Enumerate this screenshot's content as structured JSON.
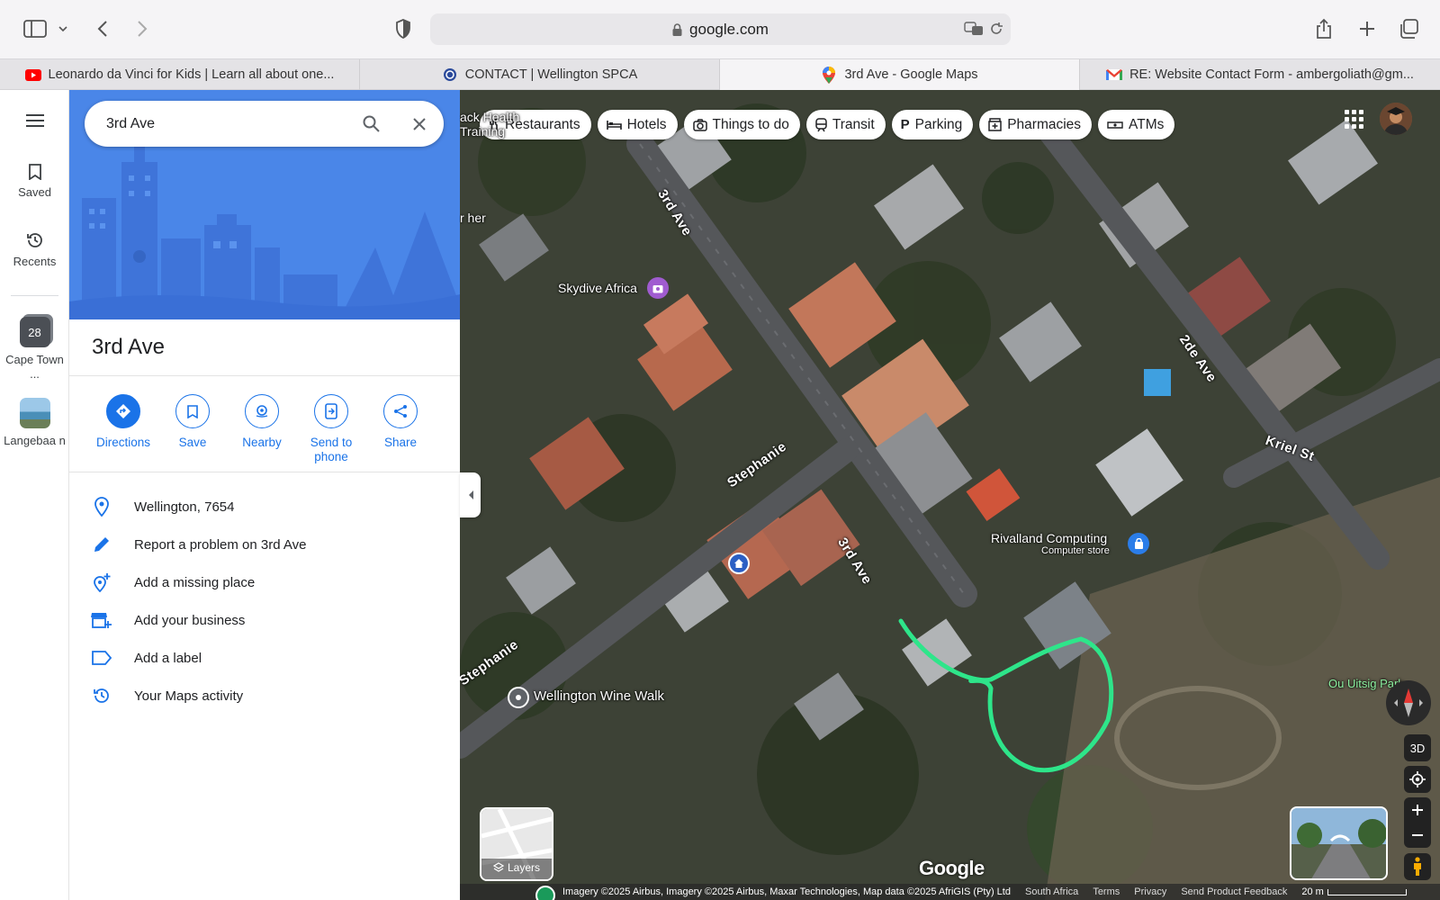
{
  "browser": {
    "url": "google.com",
    "tabs": [
      {
        "label": "Leonardo da Vinci for Kids | Learn all about one...",
        "active": false
      },
      {
        "label": "CONTACT | Wellington SPCA",
        "active": false
      },
      {
        "label": "3rd Ave - Google Maps",
        "active": true
      },
      {
        "label": "RE: Website Contact Form - ambergoliath@gm...",
        "active": false
      }
    ]
  },
  "rail": {
    "saved": "Saved",
    "recents": "Recents",
    "cape_town_badge": "28",
    "cape_town": "Cape Town ...",
    "langebaan": "Langebaa n"
  },
  "search": {
    "value": "3rd Ave"
  },
  "place": {
    "title": "3rd Ave",
    "actions": [
      {
        "label": "Directions"
      },
      {
        "label": "Save"
      },
      {
        "label": "Nearby"
      },
      {
        "label": "Send to phone"
      },
      {
        "label": "Share"
      }
    ],
    "info": [
      {
        "label": "Wellington, 7654"
      },
      {
        "label": "Report a problem on 3rd Ave"
      },
      {
        "label": "Add a missing place"
      },
      {
        "label": "Add your business"
      },
      {
        "label": "Add a label"
      },
      {
        "label": "Your Maps activity"
      }
    ]
  },
  "map": {
    "chips": [
      "Restaurants",
      "Hotels",
      "Things to do",
      "Transit",
      "Parking",
      "Pharmacies",
      "ATMs"
    ],
    "labels": {
      "health": "ack Health Training",
      "her": "r her",
      "skydive": "Skydive Africa",
      "rivalland": "Rivalland Computing",
      "rivalland_sub": "Computer store",
      "wine_walk": "Wellington Wine Walk",
      "ou_uitsig": "Ou Uitsig Park"
    },
    "streets": {
      "third_ave_top": "3rd Ave",
      "third_ave_mid": "3rd Ave",
      "stephanie_1": "Stephanie",
      "stephanie_2": "Stephanie",
      "second_ave": "2de Ave",
      "kriel": "Kriel St"
    },
    "layers": "Layers",
    "three_d": "3D",
    "google": "Google",
    "attribution": {
      "imagery": "Imagery ©2025 Airbus, Imagery ©2025 Airbus, Maxar Technologies, Map data ©2025 AfriGIS (Pty) Ltd",
      "region": "South Africa",
      "terms": "Terms",
      "privacy": "Privacy",
      "feedback": "Send Product Feedback",
      "scale": "20 m"
    },
    "colors": {
      "highlight": "#2ee58a",
      "accent": "#1a73e8"
    }
  }
}
